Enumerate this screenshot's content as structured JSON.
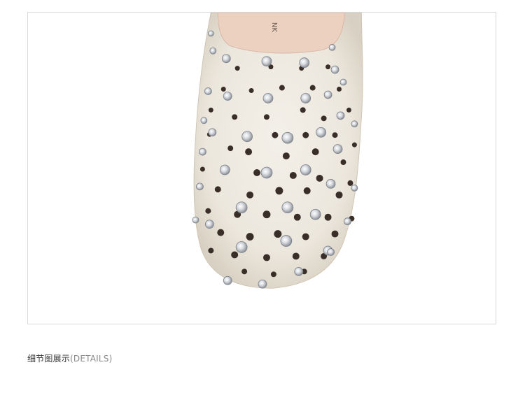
{
  "caption": {
    "title": "细节图展示",
    "subtitle": "(DETAILS)"
  },
  "product_photo": {
    "subject": "shoe-toe-closeup",
    "colors": {
      "suede": "#efebe2",
      "suede_shadow": "#d9d2c4",
      "lining": "#e9c9b9",
      "holes": "#3a2e28",
      "rhinestone": "#c9ccd1",
      "frame_border": "#d9d9d9"
    }
  }
}
